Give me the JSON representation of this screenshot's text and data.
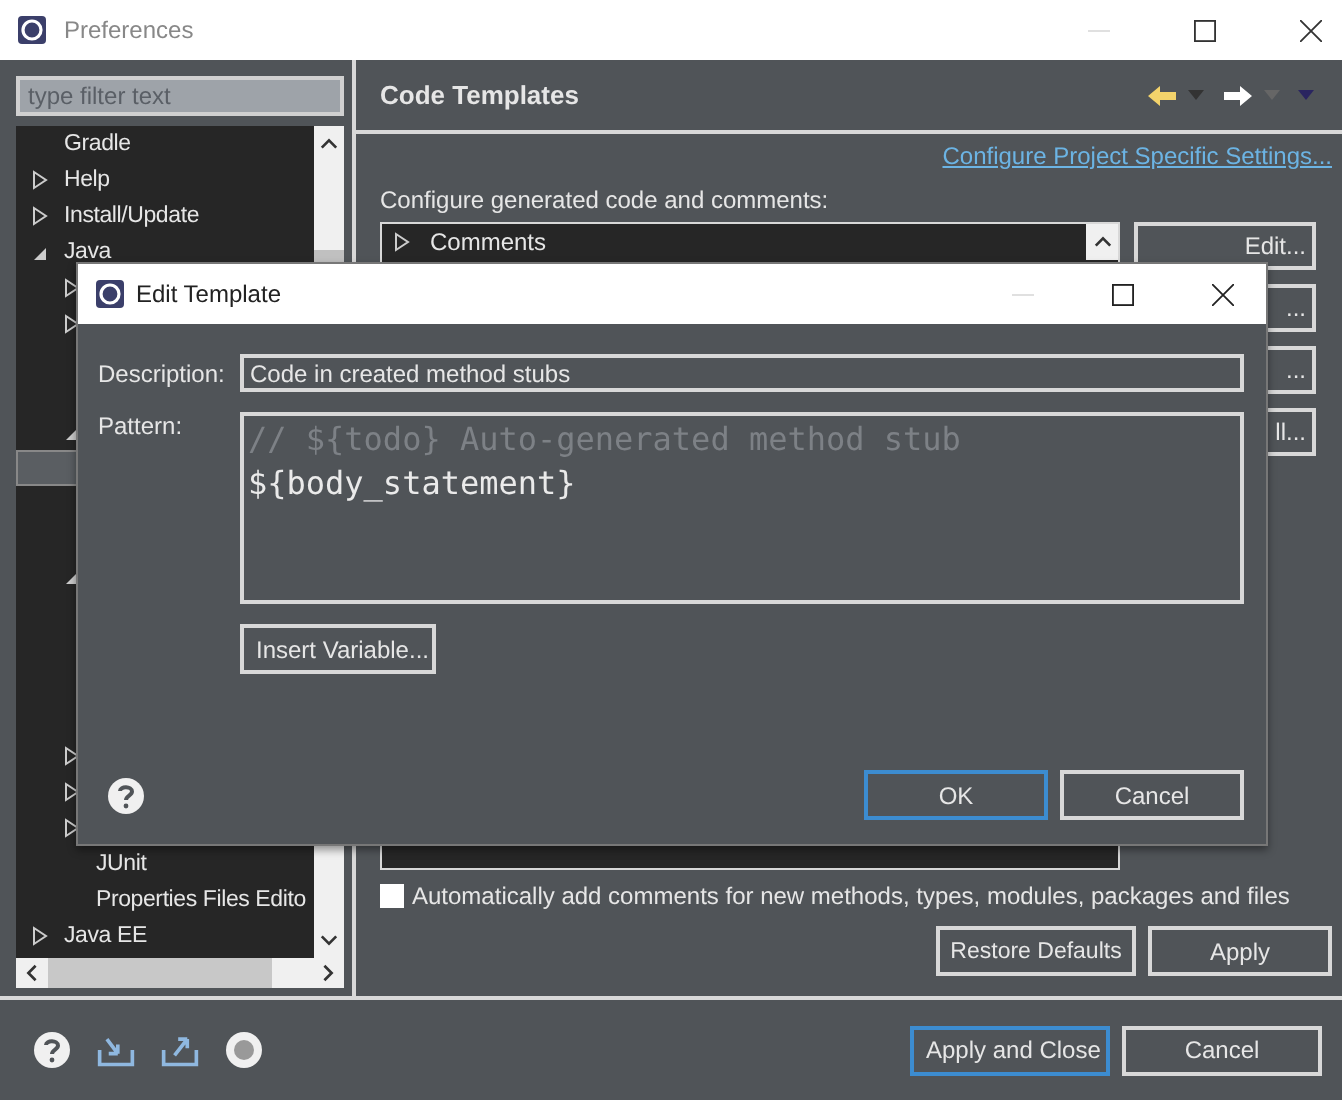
{
  "window": {
    "title": "Preferences"
  },
  "sidebar": {
    "filter": {
      "placeholder": "type filter text"
    },
    "items": [
      {
        "label": "Gradle",
        "selected": false
      },
      {
        "label": "Help",
        "selected": false,
        "expanded": false
      },
      {
        "label": "Install/Update",
        "selected": false,
        "expanded": false
      },
      {
        "label": "Java",
        "selected": false,
        "expanded": true,
        "children": [
          {
            "selected": false,
            "expanded": false
          },
          {
            "selected": false,
            "expanded": false
          },
          {
            "selected": false,
            "expanded": true,
            "children": [
              {
                "selected": true
              }
            ]
          },
          {
            "selected": false,
            "expanded": true
          },
          {
            "selected": false,
            "expanded": false
          },
          {
            "selected": false,
            "expanded": false
          },
          {
            "selected": false,
            "expanded": false
          },
          {
            "label": "JUnit",
            "selected": false
          },
          {
            "label": "Properties Files Edito",
            "selected": false
          }
        ]
      },
      {
        "label": "Java EE",
        "selected": false,
        "expanded": false
      }
    ]
  },
  "page": {
    "title": "Code Templates",
    "link": "Configure Project Specific Settings...",
    "intro": "Configure generated code and comments:",
    "tree": [
      {
        "label": "Comments",
        "expanded": false
      }
    ],
    "side_buttons": [
      "Edit...",
      "...",
      "...",
      "ll..."
    ],
    "auto_comments": {
      "label": "Automatically add comments for new methods, types, modules, packages and files",
      "checked": false
    },
    "buttons": [
      "Restore Defaults",
      "Apply"
    ]
  },
  "footer": {
    "buttons": [
      {
        "label": "Apply and Close",
        "default": true
      },
      {
        "label": "Cancel",
        "default": false
      }
    ]
  },
  "dialog": {
    "title": "Edit Template",
    "description_label": "Description:",
    "description": "Code in created method stubs",
    "pattern_label": "Pattern:",
    "pattern": [
      {
        "kind": "comment",
        "text": "// ${todo} Auto-generated method stub"
      },
      {
        "kind": "code",
        "text": "${body_statement}"
      }
    ],
    "insert_button": "Insert Variable...",
    "buttons": [
      {
        "label": "OK",
        "default": true
      },
      {
        "label": "Cancel",
        "default": false
      }
    ]
  }
}
